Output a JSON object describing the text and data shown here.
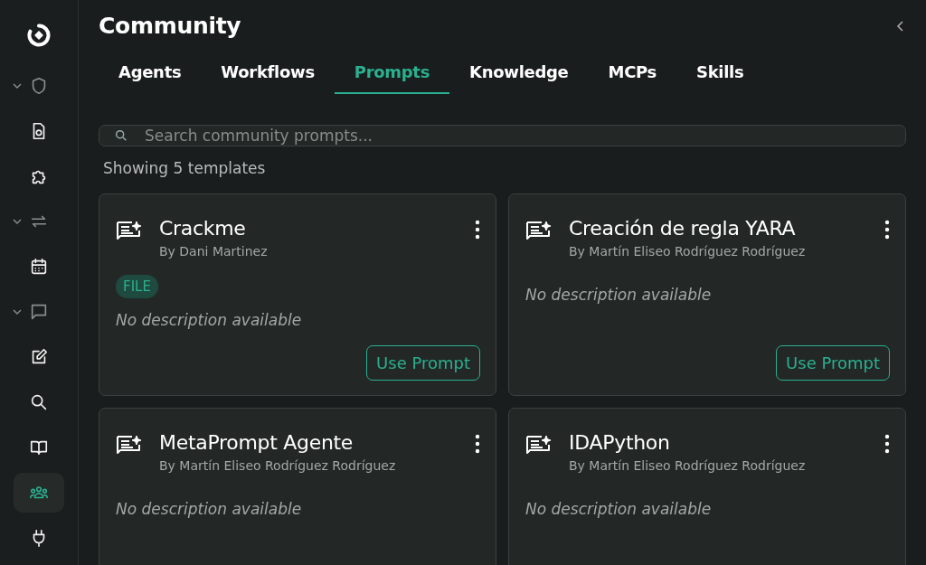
{
  "sidebar": {
    "items": [
      {
        "kind": "logo"
      },
      {
        "kind": "group",
        "expanded": true
      },
      {
        "kind": "item",
        "selected": false
      },
      {
        "kind": "item",
        "selected": false
      },
      {
        "kind": "group",
        "expanded": true
      },
      {
        "kind": "item",
        "selected": false
      },
      {
        "kind": "group",
        "expanded": true
      },
      {
        "kind": "item",
        "selected": false
      },
      {
        "kind": "item",
        "selected": false
      },
      {
        "kind": "item",
        "selected": false
      },
      {
        "kind": "item",
        "selected": true
      },
      {
        "kind": "item",
        "selected": false
      }
    ]
  },
  "header": {
    "title": "Community"
  },
  "tabs": [
    {
      "label": "Agents",
      "selected": false
    },
    {
      "label": "Workflows",
      "selected": false
    },
    {
      "label": "Prompts",
      "selected": true
    },
    {
      "label": "Knowledge",
      "selected": false
    },
    {
      "label": "MCPs",
      "selected": false
    },
    {
      "label": "Skills",
      "selected": false
    }
  ],
  "search": {
    "placeholder": "Search community prompts..."
  },
  "count": "Showing 5 templates",
  "cards": [
    {
      "title": "Crackme",
      "author": "By Dani Martinez",
      "tag": "FILE",
      "description": "No description available",
      "button": "Use Prompt"
    },
    {
      "title": "Creación de regla YARA",
      "author": "By Martín Eliseo Rodríguez Rodríguez",
      "description": "No description available",
      "button": "Use Prompt"
    },
    {
      "title": "MetaPrompt Agente",
      "author": "By Martín Eliseo Rodríguez Rodríguez",
      "description": "No description available"
    },
    {
      "title": "IDAPython",
      "author": "By Martín Eliseo Rodríguez Rodríguez",
      "description": "No description available"
    }
  ]
}
